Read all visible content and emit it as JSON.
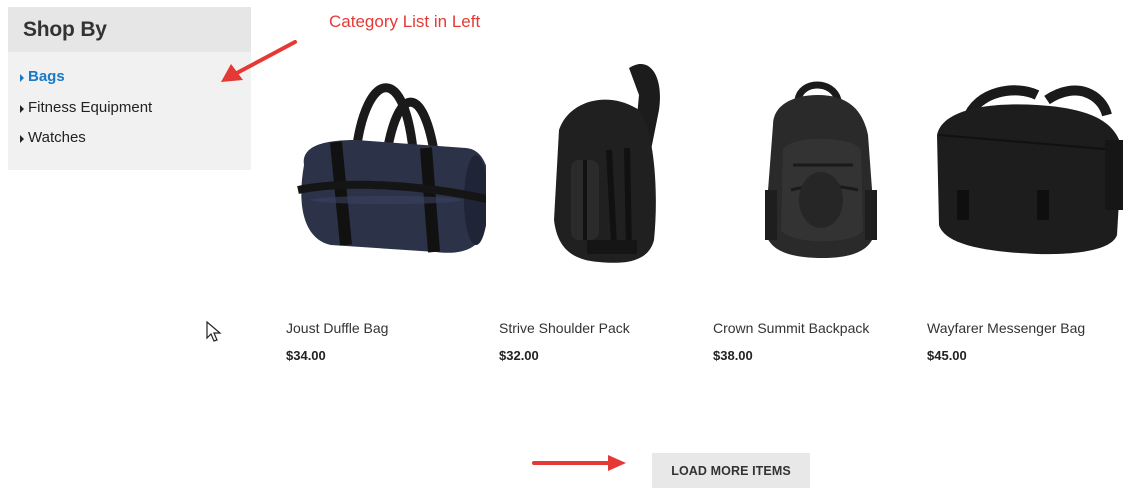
{
  "sidebar": {
    "title": "Shop By",
    "categories": [
      {
        "label": "Bags",
        "active": true
      },
      {
        "label": "Fitness Equipment",
        "active": false
      },
      {
        "label": "Watches",
        "active": false
      }
    ]
  },
  "annotation": {
    "text": "Category List in Left",
    "color": "#e53935"
  },
  "products": [
    {
      "name": "Joust Duffle Bag",
      "price": "$34.00",
      "image_icon": "duffle-bag-icon"
    },
    {
      "name": "Strive Shoulder Pack",
      "price": "$32.00",
      "image_icon": "shoulder-pack-icon"
    },
    {
      "name": "Crown Summit Backpack",
      "price": "$38.00",
      "image_icon": "backpack-icon"
    },
    {
      "name": "Wayfarer Messenger Bag",
      "price": "$45.00",
      "image_icon": "messenger-bag-icon"
    }
  ],
  "load_more": {
    "label": "LOAD MORE ITEMS"
  },
  "colors": {
    "active_link": "#1979c3",
    "sidebar_bg": "#f1f1f1",
    "sidebar_header_bg": "#e6e6e6",
    "button_bg": "#e8e8e8"
  }
}
